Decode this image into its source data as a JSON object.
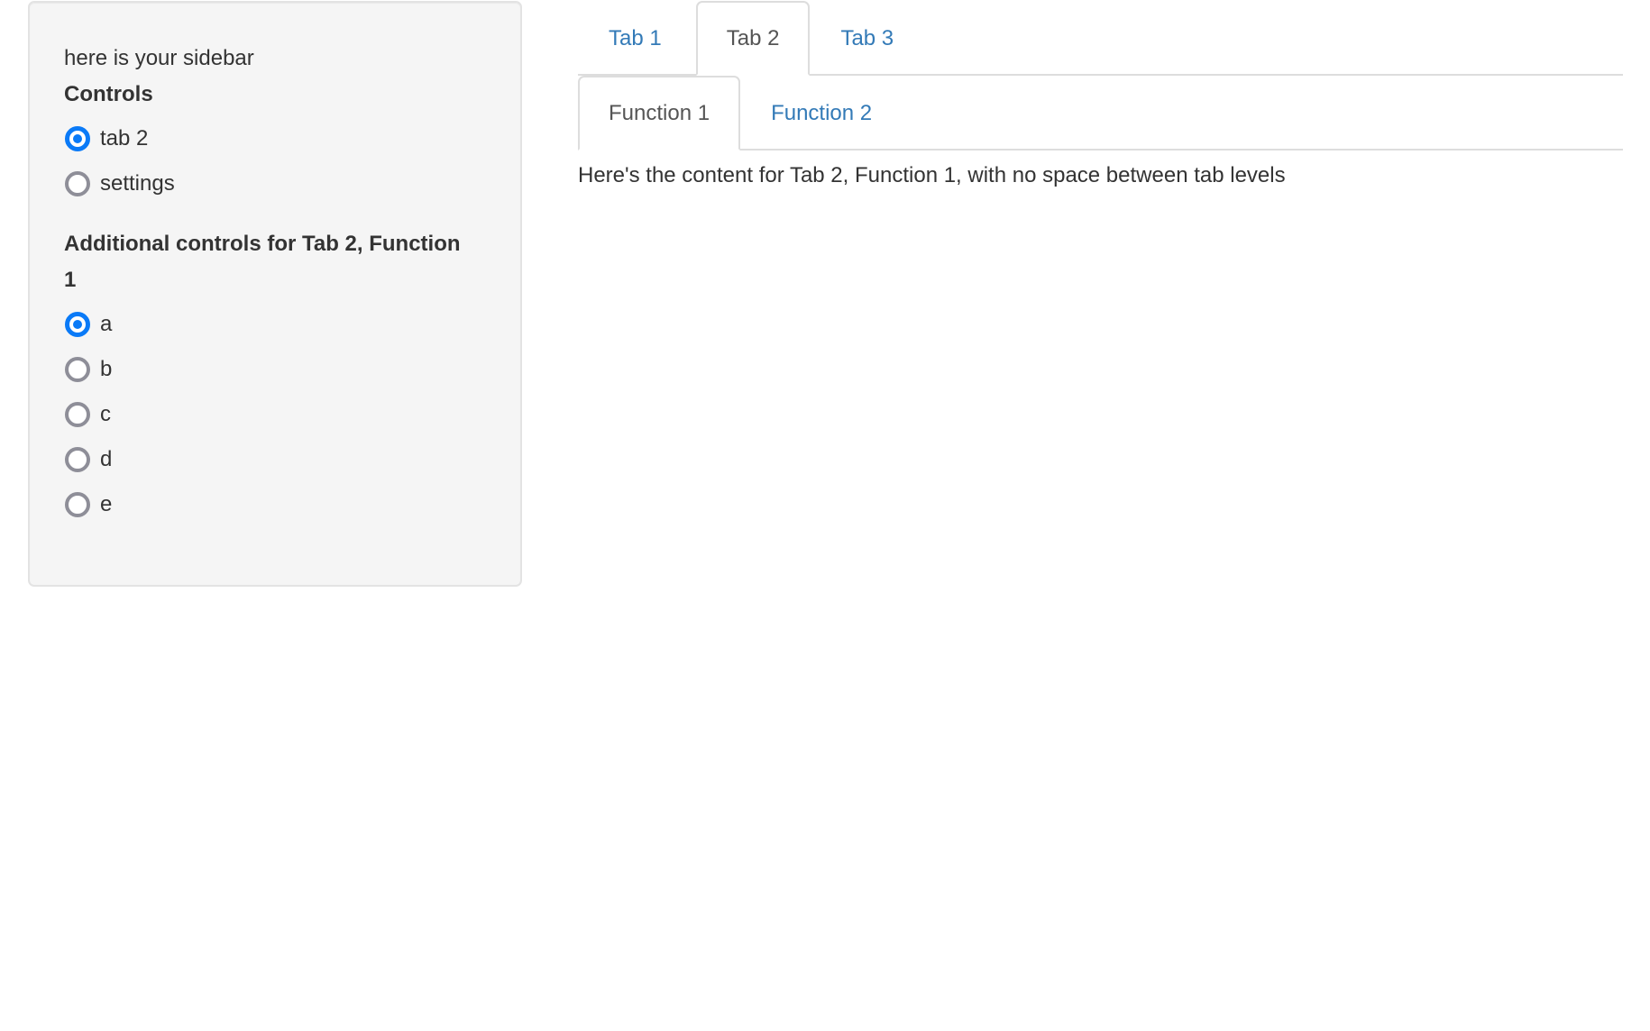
{
  "sidebar": {
    "intro_text": "here is your sidebar",
    "controls": {
      "label": "Controls",
      "options": [
        {
          "label": "tab 2",
          "checked": true
        },
        {
          "label": "settings",
          "checked": false
        }
      ]
    },
    "additional_controls": {
      "label": "Additional controls for Tab 2, Function 1",
      "options": [
        {
          "label": "a",
          "checked": true
        },
        {
          "label": "b",
          "checked": false
        },
        {
          "label": "c",
          "checked": false
        },
        {
          "label": "d",
          "checked": false
        },
        {
          "label": "e",
          "checked": false
        }
      ]
    }
  },
  "main": {
    "tabs": [
      {
        "label": "Tab 1",
        "active": false
      },
      {
        "label": "Tab 2",
        "active": true
      },
      {
        "label": "Tab 3",
        "active": false
      }
    ],
    "sub_tabs": [
      {
        "label": "Function 1",
        "active": true
      },
      {
        "label": "Function 2",
        "active": false
      }
    ],
    "content": "Here's the content for Tab 2, Function 1, with no space between tab levels"
  },
  "colors": {
    "link": "#337ab7",
    "active_tab_text": "#555555",
    "radio_checked": "#0a7af7",
    "radio_unchecked": "#8e8e98",
    "sidebar_bg": "#f5f5f5",
    "border": "#dddddd"
  }
}
